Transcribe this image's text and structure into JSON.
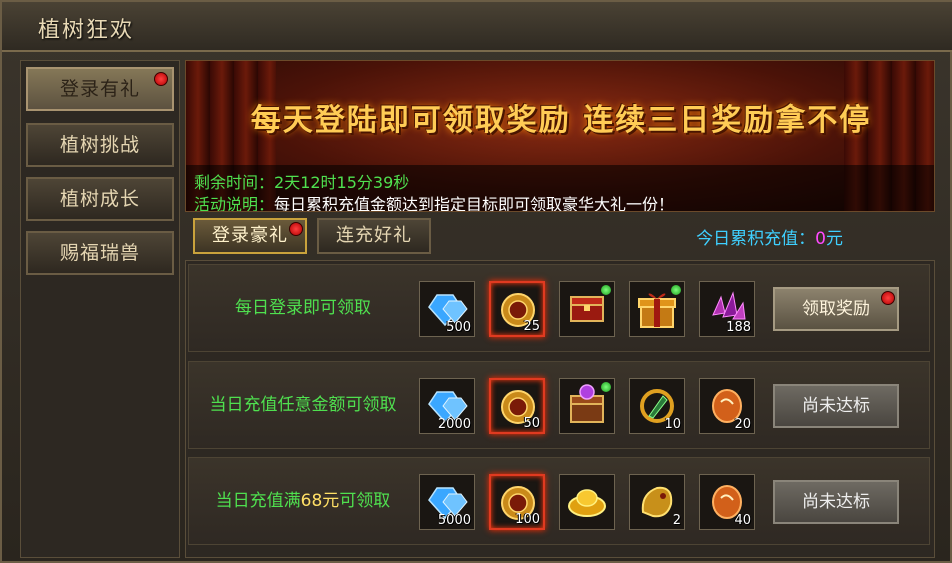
{
  "window": {
    "title": "植树狂欢"
  },
  "sidebar": {
    "items": [
      {
        "label": "登录有礼",
        "active": true,
        "badge": true
      },
      {
        "label": "植树挑战"
      },
      {
        "label": "植树成长"
      },
      {
        "label": "赐福瑞兽"
      }
    ]
  },
  "banner": {
    "headline": "每天登陆即可领取奖励 连续三日奖励拿不停",
    "remaining_label": "剩余时间：",
    "remaining_value": "2天12时15分39秒",
    "desc_label": "活动说明：",
    "desc_value": "每日累积充值金额达到指定目标即可领取豪华大礼一份！"
  },
  "tabs": [
    {
      "label": "登录豪礼",
      "active": true,
      "badge": true
    },
    {
      "label": "连充好礼"
    }
  ],
  "today_recharge": {
    "label": "今日累积充值：",
    "value": "0",
    "unit": "元"
  },
  "rows": [
    {
      "label_pre": "每日登录即可领取",
      "label_highlight": "",
      "label_post": "",
      "items": [
        {
          "icon": "blue-gem-icon",
          "qty": "500"
        },
        {
          "icon": "gold-coin-icon",
          "qty": "25",
          "glow": true
        },
        {
          "icon": "red-chest-icon",
          "qty": "",
          "dot": true
        },
        {
          "icon": "gift-box-icon",
          "qty": "",
          "dot": true
        },
        {
          "icon": "purple-crystal-icon",
          "qty": "188"
        }
      ],
      "button": "领取奖励",
      "button_enabled": true,
      "button_badge": true
    },
    {
      "label_pre": "当日充值任意金额可领取",
      "label_highlight": "",
      "label_post": "",
      "items": [
        {
          "icon": "blue-gem-icon",
          "qty": "2000"
        },
        {
          "icon": "gold-coin-icon",
          "qty": "50",
          "glow": true
        },
        {
          "icon": "purple-chest-icon",
          "qty": "",
          "dot": true
        },
        {
          "icon": "amulet-icon",
          "qty": "10"
        },
        {
          "icon": "orange-stone-icon",
          "qty": "20"
        }
      ],
      "button": "尚未达标",
      "button_enabled": false
    },
    {
      "label_pre": "当日充值满",
      "label_highlight": "68元",
      "label_post": "可领取",
      "items": [
        {
          "icon": "blue-gem-icon",
          "qty": "5000"
        },
        {
          "icon": "gold-coin-icon",
          "qty": "100",
          "glow": true
        },
        {
          "icon": "gold-ingot-icon",
          "qty": ""
        },
        {
          "icon": "gold-dragon-icon",
          "qty": "2"
        },
        {
          "icon": "orange-stone-icon",
          "qty": "40"
        }
      ],
      "button": "尚未达标",
      "button_enabled": false
    }
  ]
}
